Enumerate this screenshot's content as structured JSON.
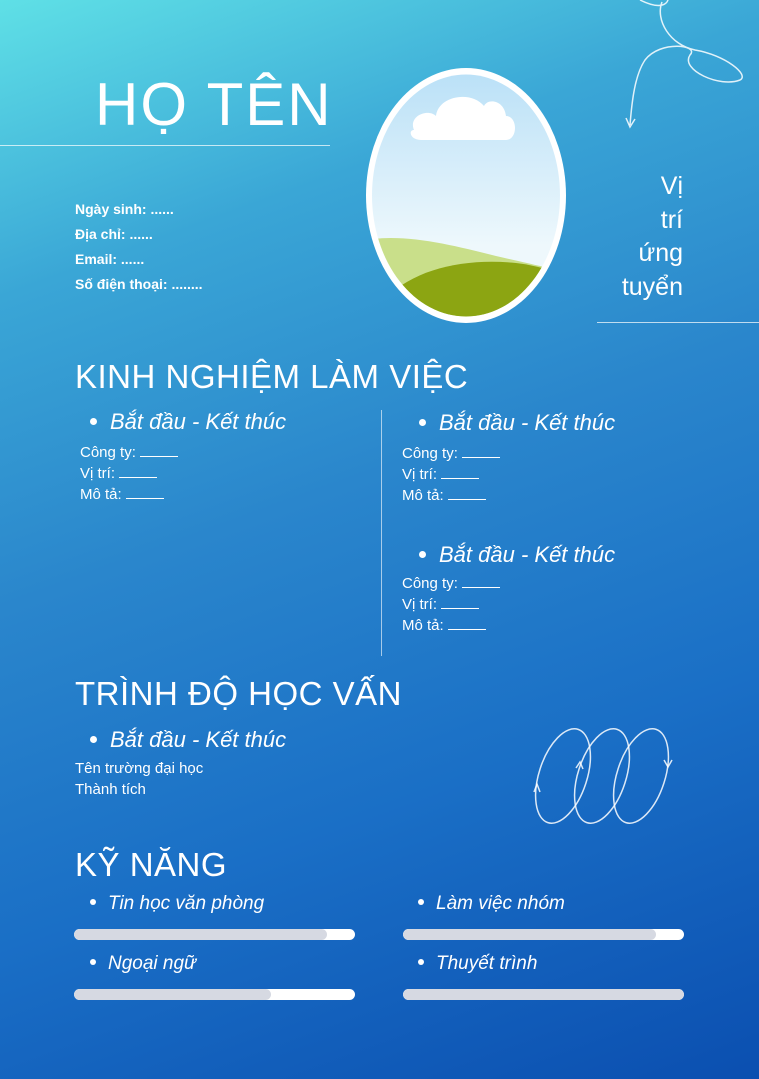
{
  "header": {
    "name": "HỌ TÊN",
    "position": [
      "Vị",
      "trí",
      "ứng",
      "tuyển"
    ]
  },
  "info": [
    {
      "label": "Ngày sinh:",
      "value": "......"
    },
    {
      "label": "Địa chỉ:",
      "value": "......"
    },
    {
      "label": "Email:",
      "value": "......"
    },
    {
      "label": "Số điện thoại:",
      "value": "........"
    }
  ],
  "experience": {
    "title": "KINH NGHIỆM LÀM VIỆC",
    "entries": [
      {
        "period": "Bắt đầu - Kết thúc",
        "company": "Công ty:",
        "role": "Vị trí:",
        "desc": "Mô tả:"
      },
      {
        "period": "Bắt đầu - Kết thúc",
        "company": "Công ty:",
        "role": "Vị trí:",
        "desc": "Mô tả:"
      },
      {
        "period": "Bắt đầu - Kết thúc",
        "company": "Công ty:",
        "role": "Vị trí:",
        "desc": "Mô tả:"
      }
    ]
  },
  "education": {
    "title": "TRÌNH ĐỘ HỌC VẤN",
    "period": "Bắt đầu - Kết thúc",
    "school": "Tên trường đại học",
    "achievement": "Thành tích"
  },
  "skills": {
    "title": "KỸ NĂNG",
    "items": [
      {
        "name": "Tin học văn phòng",
        "level": 0.9
      },
      {
        "name": "Làm việc nhóm",
        "level": 0.9
      },
      {
        "name": "Ngoại ngữ",
        "level": 0.7
      },
      {
        "name": "Thuyết trình",
        "level": 1.0
      }
    ]
  },
  "colors": {
    "bar_fill": "#d6d9e2",
    "bar_track": "#ffffff",
    "accent": "#ffffff"
  }
}
